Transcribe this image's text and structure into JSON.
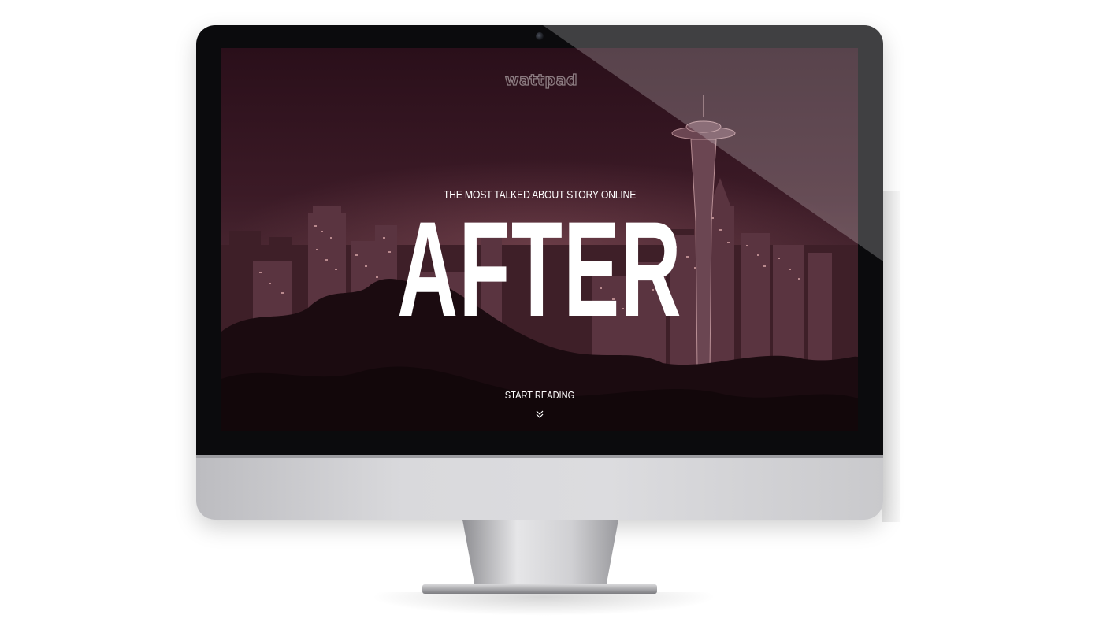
{
  "brand": {
    "logo_text": "wattpad"
  },
  "hero": {
    "tagline": "THE MOST TALKED ABOUT STORY ONLINE",
    "title": "AFTER",
    "cta_label": "START READING"
  },
  "icons": {
    "scroll_indicator": "double-chevron-down-icon",
    "camera": "webcam-icon"
  },
  "colors": {
    "overlay_tint": "#3b1a26",
    "text": "#ffffff",
    "logo_outline": "#8d7d82",
    "bezel": "#0b0b0d",
    "aluminum": "#d9d9dc"
  }
}
